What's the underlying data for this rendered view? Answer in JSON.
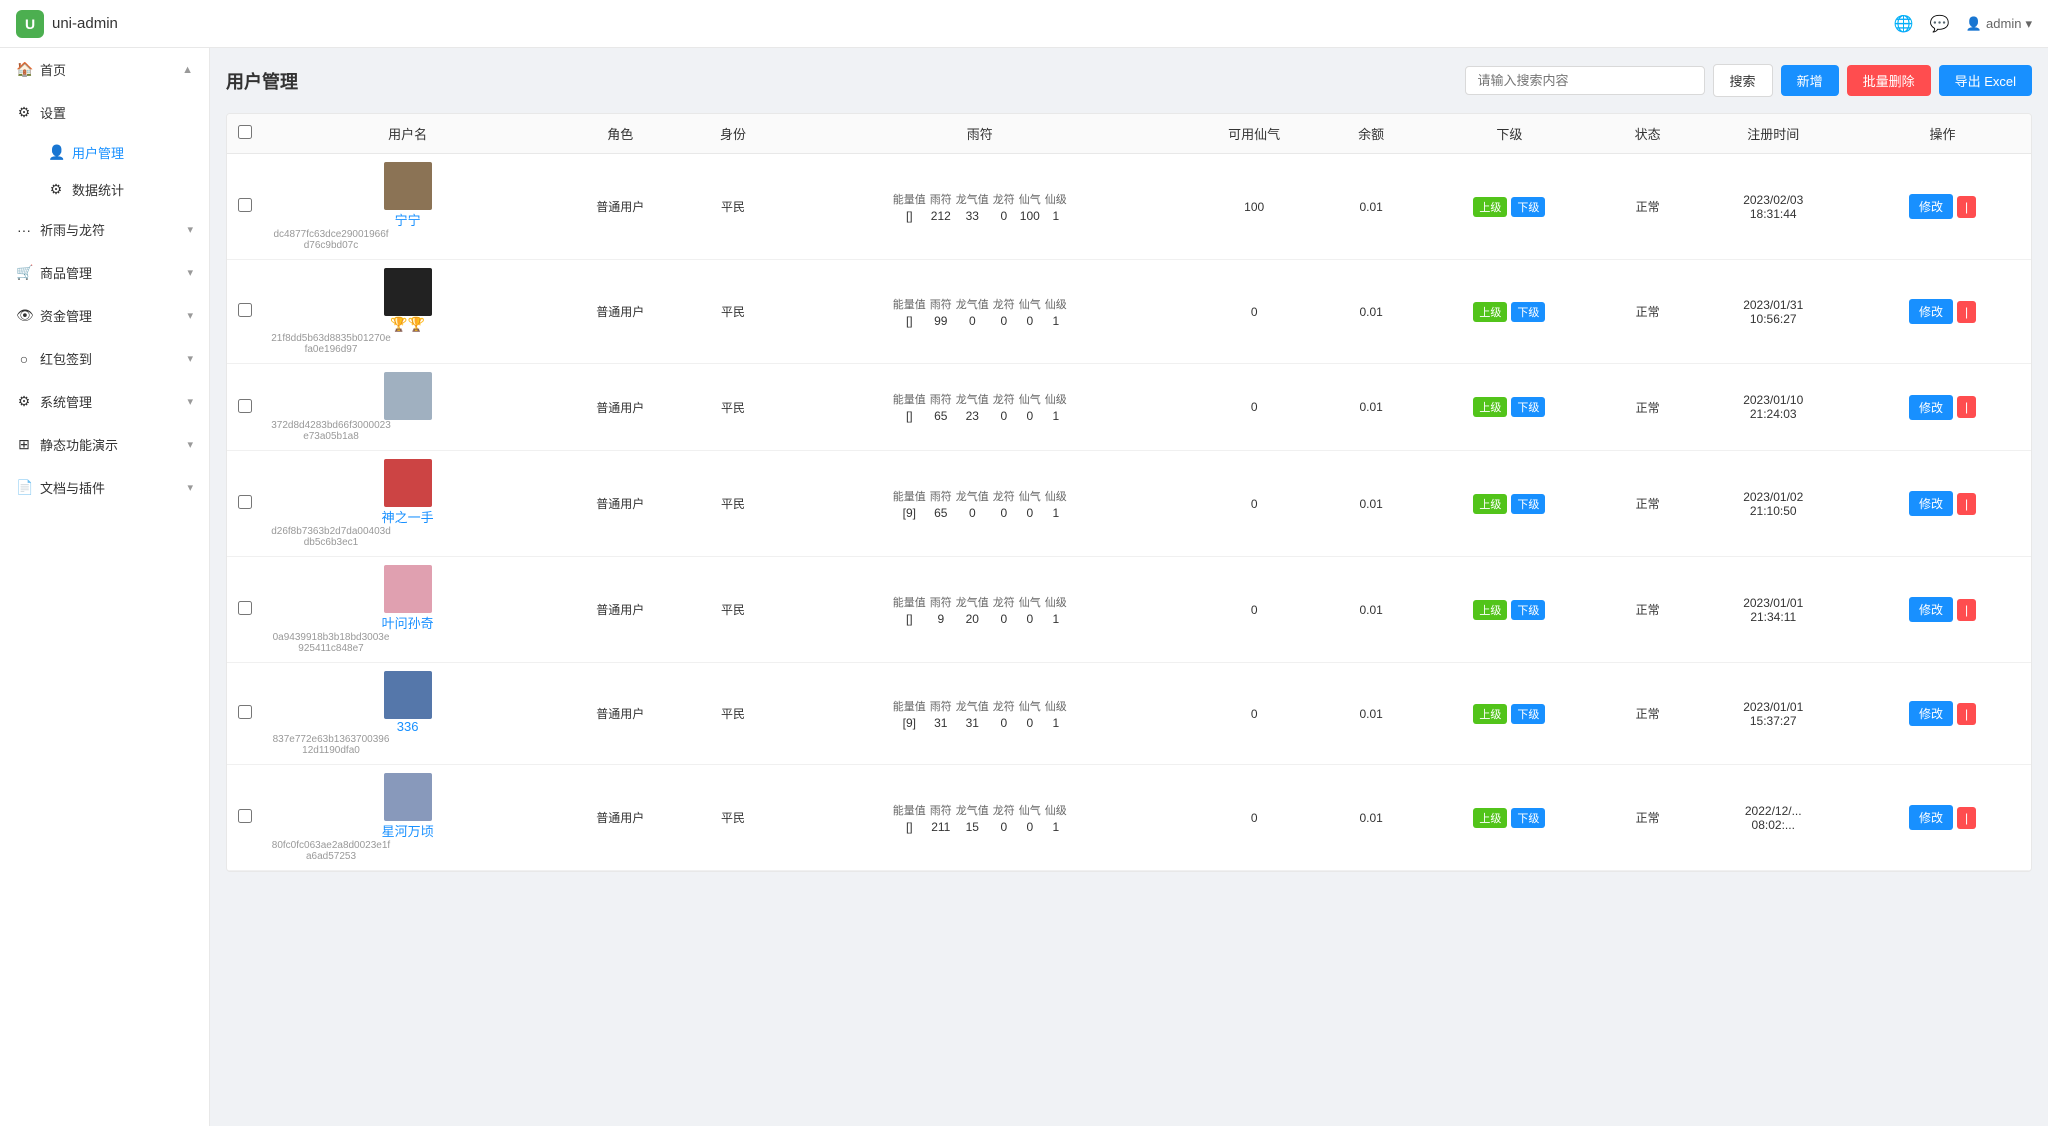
{
  "header": {
    "logo": "U",
    "title": "uni-admin",
    "admin_label": "admin",
    "icons": [
      "🌐",
      "💬",
      "👤"
    ]
  },
  "sidebar": {
    "home": "首页",
    "settings": "设置",
    "sub_items": [
      {
        "label": "用户管理",
        "active": true,
        "icon": "👤"
      }
    ],
    "data_stats": "数据统计",
    "prayer": "祈雨与龙符",
    "goods": "商品管理",
    "funds": "资金管理",
    "redpack": "红包签到",
    "system": "系统管理",
    "static": "静态功能演示",
    "docs": "文档与插件"
  },
  "page": {
    "title": "用户管理",
    "search_placeholder": "请输入搜索内容",
    "btn_search": "搜索",
    "btn_add": "新增",
    "btn_batch_delete": "批量删除",
    "btn_export": "导出 Excel"
  },
  "table": {
    "columns": [
      "用户名",
      "角色",
      "身份",
      "雨符",
      "可用仙气",
      "余额",
      "下级",
      "状态",
      "注册时间",
      "操作"
    ],
    "rain_sub": [
      "能量值",
      "雨符",
      "龙气值",
      "龙符",
      "仙气",
      "仙级"
    ],
    "rows": [
      {
        "id": 1,
        "name": "宁宁",
        "hash": "dc4877fc63dce29001966fd76c9bd07c",
        "avatar_color": "#8b7355",
        "role": "普通用户",
        "identity": "平民",
        "energy": "[]",
        "rain": "212",
        "dragon_qi": "33",
        "dragon_fu": "0",
        "xian_qi": "100",
        "xian_ji": "1",
        "avail_qi": "100",
        "balance": "0.01",
        "date": "2023/02/03",
        "time": "18:31:44",
        "status": "正常",
        "trophies": []
      },
      {
        "id": 2,
        "name": "",
        "hash": "21f8dd5b63d8835b01270efa0e196d97",
        "avatar_color": "#222",
        "role": "普通用户",
        "identity": "平民",
        "energy": "[]",
        "rain": "99",
        "dragon_qi": "0",
        "dragon_fu": "0",
        "xian_qi": "0",
        "xian_ji": "1",
        "avail_qi": "0",
        "balance": "0.01",
        "date": "2023/01/31",
        "time": "10:56:27",
        "status": "正常",
        "trophies": [
          "🏆",
          "🏆"
        ]
      },
      {
        "id": 3,
        "name": "",
        "hash": "372d8d4283bd66f3000023e73a05b1a8",
        "avatar_color": "#a0b0c0",
        "role": "普通用户",
        "identity": "平民",
        "energy": "[]",
        "rain": "65",
        "dragon_qi": "23",
        "dragon_fu": "0",
        "xian_qi": "0",
        "xian_ji": "1",
        "avail_qi": "0",
        "balance": "0.01",
        "date": "2023/01/10",
        "time": "21:24:03",
        "status": "正常",
        "trophies": []
      },
      {
        "id": 4,
        "name": "神之一手",
        "hash": "d26f8b7363b2d7da00403ddb5c6b3ec1",
        "avatar_color": "#c44",
        "role": "普通用户",
        "identity": "平民",
        "energy": "[9]",
        "rain": "65",
        "dragon_qi": "0",
        "dragon_fu": "0",
        "xian_qi": "0",
        "xian_ji": "1",
        "avail_qi": "0",
        "balance": "0.01",
        "date": "2023/01/02",
        "time": "21:10:50",
        "status": "正常",
        "trophies": []
      },
      {
        "id": 5,
        "name": "叶问孙奇",
        "hash": "0a9439918b3b18bd3003e925411c848e7",
        "avatar_color": "#e0a0b0",
        "role": "普通用户",
        "identity": "平民",
        "energy": "[]",
        "rain": "9",
        "dragon_qi": "20",
        "dragon_fu": "0",
        "xian_qi": "0",
        "xian_ji": "1",
        "avail_qi": "0",
        "balance": "0.01",
        "date": "2023/01/01",
        "time": "21:34:11",
        "status": "正常",
        "trophies": []
      },
      {
        "id": 6,
        "name": "336",
        "hash": "837e772e63b136370039612d1190dfa0",
        "avatar_color": "#5577aa",
        "role": "普通用户",
        "identity": "平民",
        "energy": "[9]",
        "rain": "31",
        "dragon_qi": "31",
        "dragon_fu": "0",
        "xian_qi": "0",
        "xian_ji": "1",
        "avail_qi": "0",
        "balance": "0.01",
        "date": "2023/01/01",
        "time": "15:37:27",
        "status": "正常",
        "trophies": []
      },
      {
        "id": 7,
        "name": "星河万顷",
        "hash": "80fc0fc063ae2a8d0023e1fa6ad57253",
        "avatar_color": "#8899bb",
        "role": "普通用户",
        "identity": "平民",
        "energy": "[]",
        "rain": "211",
        "dragon_qi": "15",
        "dragon_fu": "0",
        "xian_qi": "0",
        "xian_ji": "1",
        "avail_qi": "0",
        "balance": "0.01",
        "date": "2022/12/...",
        "time": "08:02:...",
        "status": "正常",
        "trophies": []
      }
    ],
    "btn_up": "上级",
    "btn_down": "下级",
    "btn_edit": "修改",
    "btn_del": "×"
  },
  "colors": {
    "primary": "#1890ff",
    "success": "#52c41a",
    "danger": "#ff4d4f",
    "accent": "#1890ff"
  }
}
